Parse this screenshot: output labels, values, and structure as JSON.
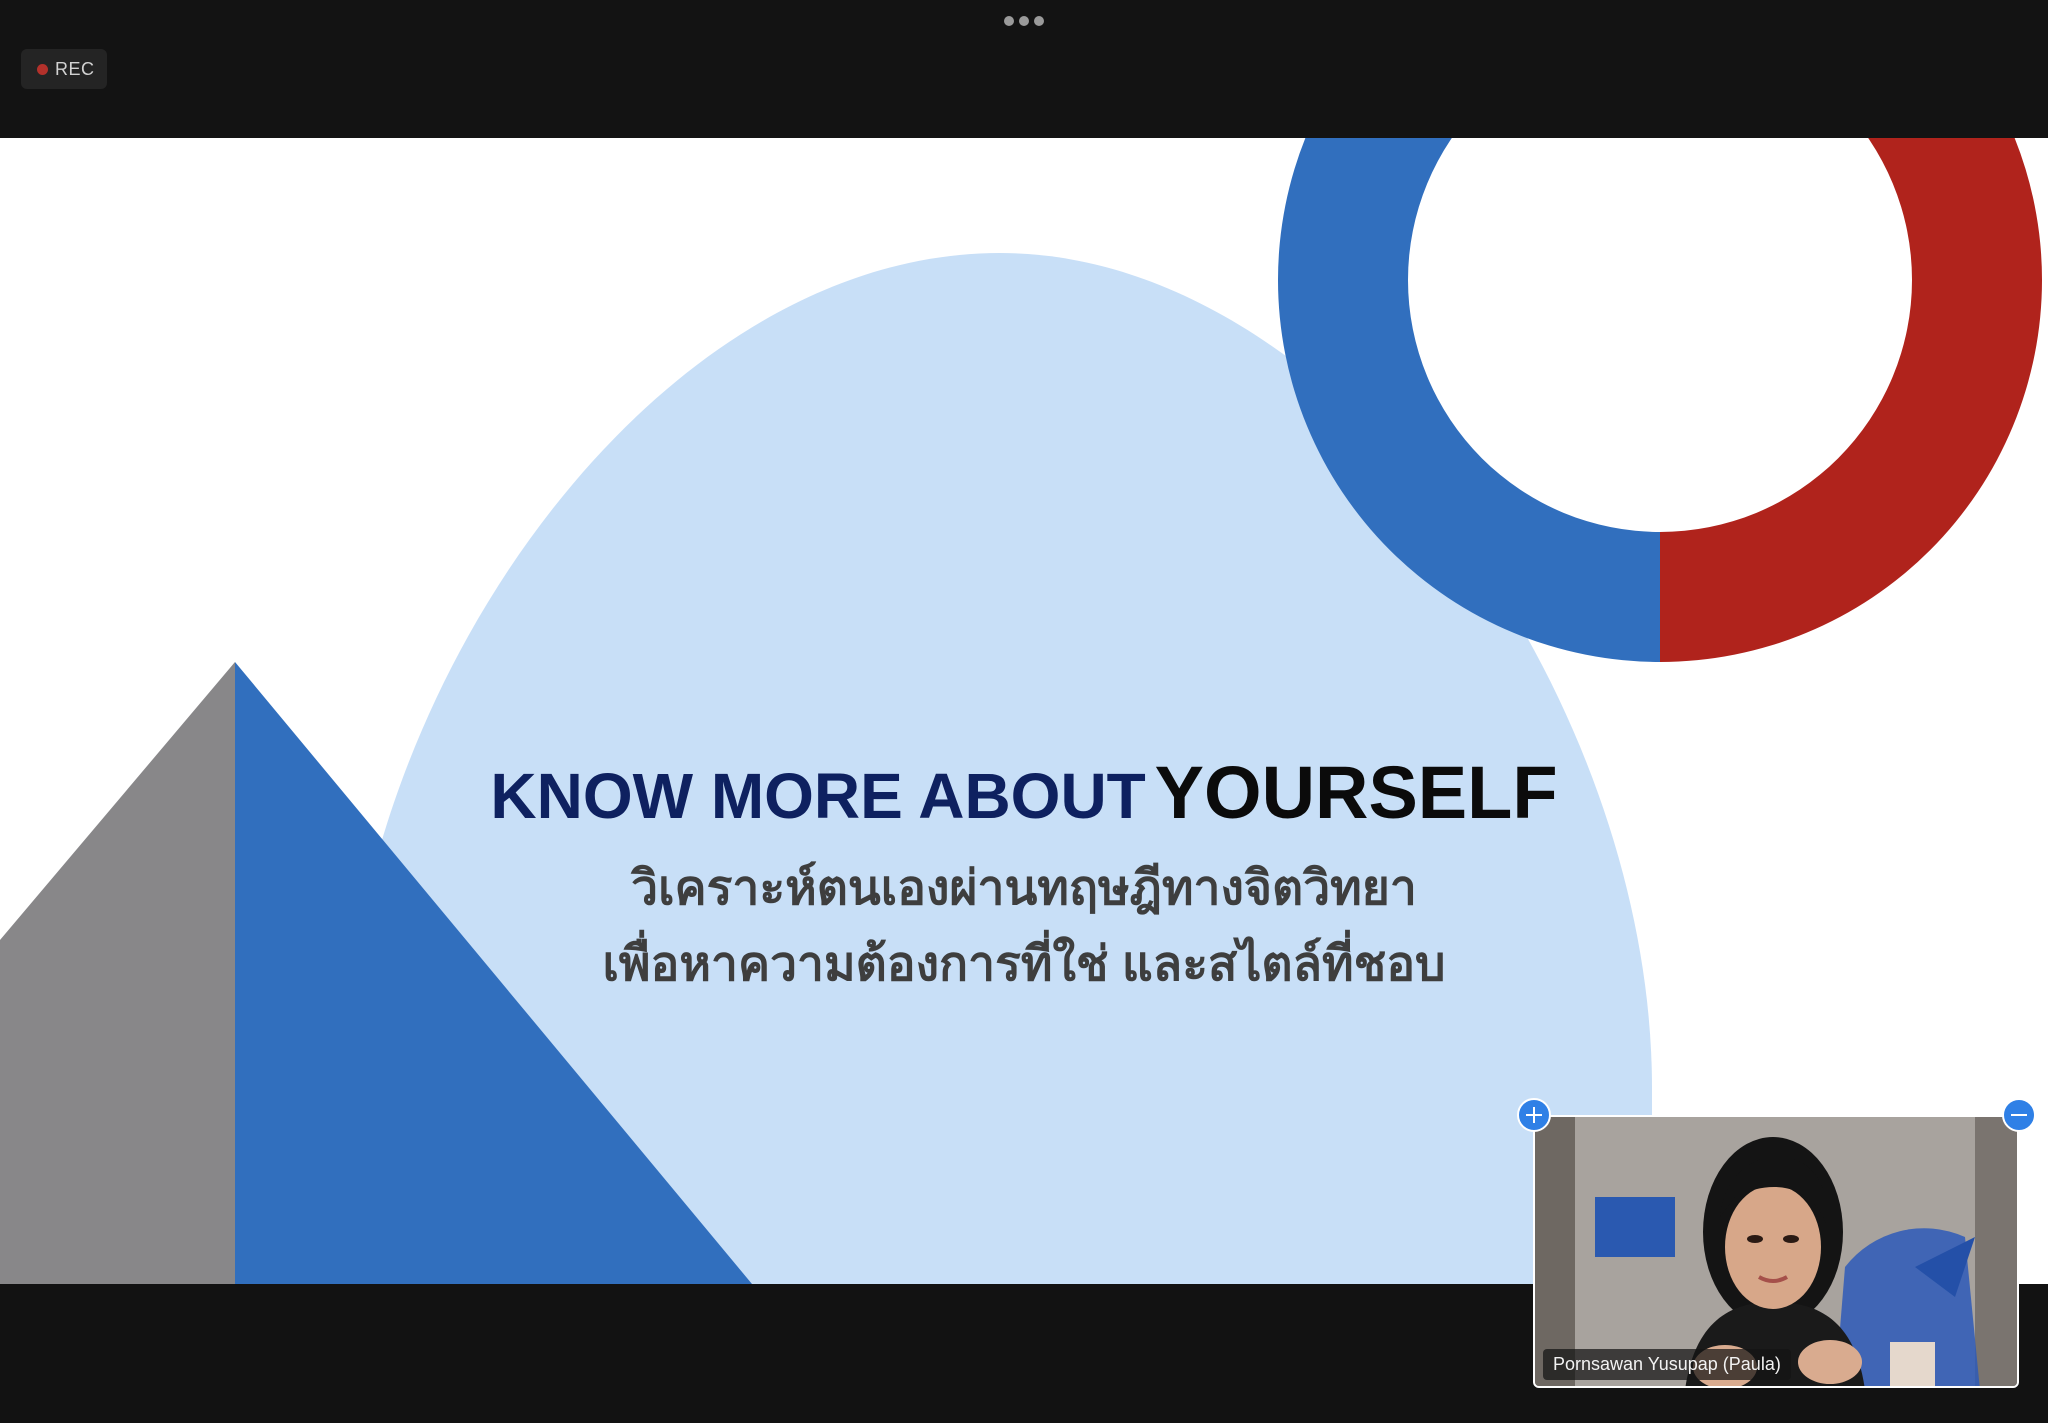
{
  "toolbar": {
    "recording_label": "REC",
    "more_options_icon": "ellipsis-icon"
  },
  "slide": {
    "title_part1": "KNOW MORE ABOUT",
    "title_part2": "YOURSELF",
    "subtitle_line1": "วิเคราะห์ตนเองผ่านทฤษฎีทางจิตวิทยา",
    "subtitle_line2": "เพื่อหาความต้องการที่ใช่ และสไตล์ที่ชอบ",
    "colors": {
      "title_navy": "#0e2160",
      "title_black": "#0b0b0b",
      "subtitle_gray": "#3e3e3e",
      "arch_light_blue": "#c8dff7",
      "accent_blue": "#316fbe",
      "accent_red": "#b0231c",
      "accent_gray": "#888789"
    }
  },
  "video_tile": {
    "participant_name": "Pornsawan Yusupap (Paula)",
    "expand_icon": "plus-icon",
    "collapse_icon": "minus-icon"
  }
}
